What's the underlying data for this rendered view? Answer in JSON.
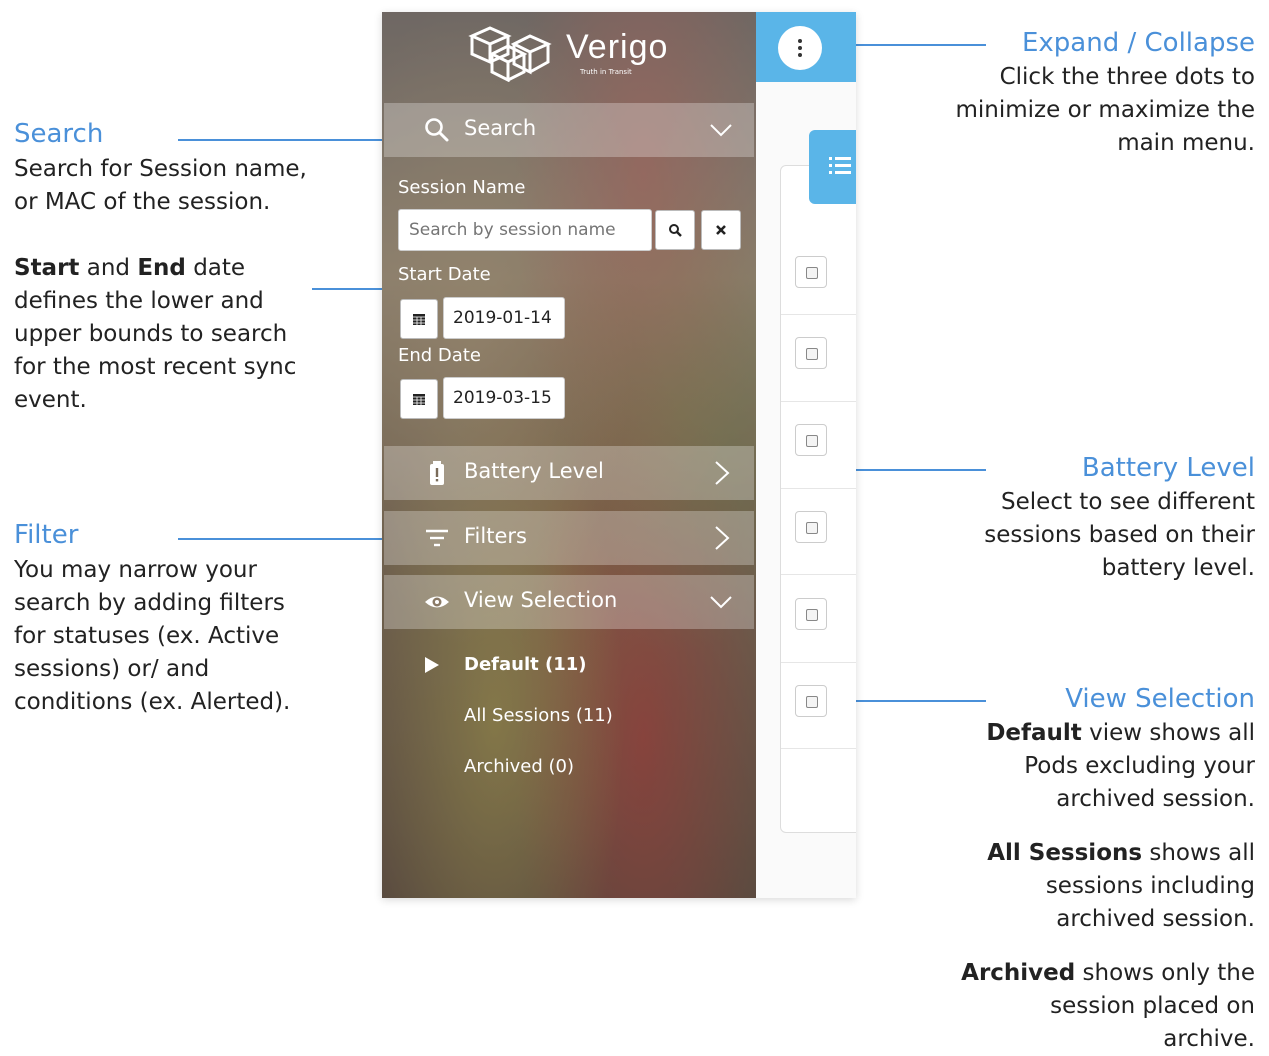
{
  "annotations": {
    "search": {
      "title": "Search",
      "text": [
        "Search for Session name,",
        "or MAC of the session."
      ]
    },
    "dates": {
      "start_word": "Start",
      "and_word": " and ",
      "end_word": "End",
      "after_end": " date",
      "lines": [
        "defines the lower and",
        "upper bounds to search",
        "for the most recent sync",
        "event."
      ]
    },
    "filter": {
      "title": "Filter",
      "text": [
        "You may narrow your",
        "search by adding filters",
        "for statuses (ex. Active",
        "sessions) or/ and",
        "conditions (ex. Alerted)."
      ]
    },
    "expand": {
      "title": "Expand / Collapse",
      "text": [
        "Click the three dots to",
        "minimize or maximize the",
        "main menu."
      ]
    },
    "battery": {
      "title": "Battery Level",
      "text": [
        "Select to see different",
        "sessions based on their",
        "battery level."
      ]
    },
    "view": {
      "title": "View Selection",
      "default_bold": "Default",
      "default_rest": " view shows all",
      "default_lines": [
        "Pods excluding your",
        "archived session."
      ],
      "all_bold": "All Sessions",
      "all_rest": " shows all",
      "all_lines": [
        "sessions including",
        "archived session."
      ],
      "archived_bold": "Archived",
      "archived_rest": " shows only the",
      "archived_lines": [
        "session placed on",
        "archive."
      ]
    }
  },
  "sidebar": {
    "logo_text": "Verigo",
    "logo_tagline": "Truth in Transit",
    "search_section": {
      "label": "Search",
      "icon": "search-icon",
      "expanded": true
    },
    "session_name_label": "Session Name",
    "session_name_placeholder": "Search by session name",
    "session_name_value": "",
    "start_date_label": "Start Date",
    "start_date_value": "2019-01-14",
    "end_date_label": "End Date",
    "end_date_value": "2019-03-15",
    "battery_section": {
      "label": "Battery Level",
      "icon": "battery-icon",
      "expanded": false
    },
    "filters_section": {
      "label": "Filters",
      "icon": "filter-icon",
      "expanded": false
    },
    "view_section": {
      "label": "View Selection",
      "icon": "eye-icon",
      "expanded": true
    },
    "view_items": [
      {
        "label": "Default (11)",
        "selected": true
      },
      {
        "label": "All Sessions (11)",
        "selected": false
      },
      {
        "label": "Archived (0)",
        "selected": false
      }
    ]
  },
  "colors": {
    "accent": "#4a90d9",
    "topbar": "#5ab5e8"
  }
}
